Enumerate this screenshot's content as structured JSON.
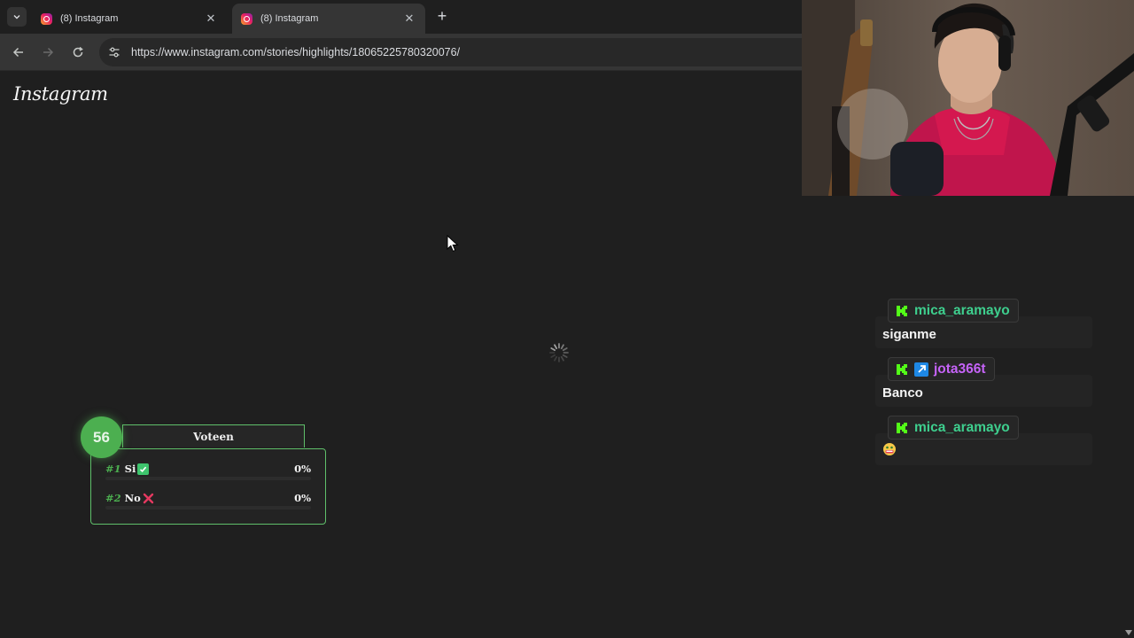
{
  "browser": {
    "tabs": [
      {
        "title": "(8) Instagram",
        "active": false
      },
      {
        "title": "(8) Instagram",
        "active": true
      }
    ],
    "url": "https://www.instagram.com/stories/highlights/18065225780320076/"
  },
  "page": {
    "logo_text": "Instagram",
    "loading": true
  },
  "poll": {
    "count": "56",
    "title": "Voteen",
    "options": [
      {
        "num": "#1",
        "label": "Si",
        "emoji": "check-mark-icon",
        "percent": "0%"
      },
      {
        "num": "#2",
        "label": "No",
        "emoji": "cross-mark-icon",
        "percent": "0%"
      }
    ]
  },
  "chat": {
    "messages": [
      {
        "username": "mica_aramayo",
        "username_color": "#3ecf8e",
        "badges": [
          "kick-badge-icon"
        ],
        "text": "siganme"
      },
      {
        "username": "jota366t",
        "username_color": "#c563f7",
        "badges": [
          "kick-badge-icon",
          "arrow-badge-icon"
        ],
        "text": "Banco"
      },
      {
        "username": "mica_aramayo",
        "username_color": "#3ecf8e",
        "badges": [
          "kick-badge-icon"
        ],
        "text": "",
        "emoji": "money-mouth-emoji"
      }
    ]
  },
  "colors": {
    "poll_accent": "#4caf50",
    "page_bg": "#1f1f1f",
    "toolbar_bg": "#353535"
  }
}
